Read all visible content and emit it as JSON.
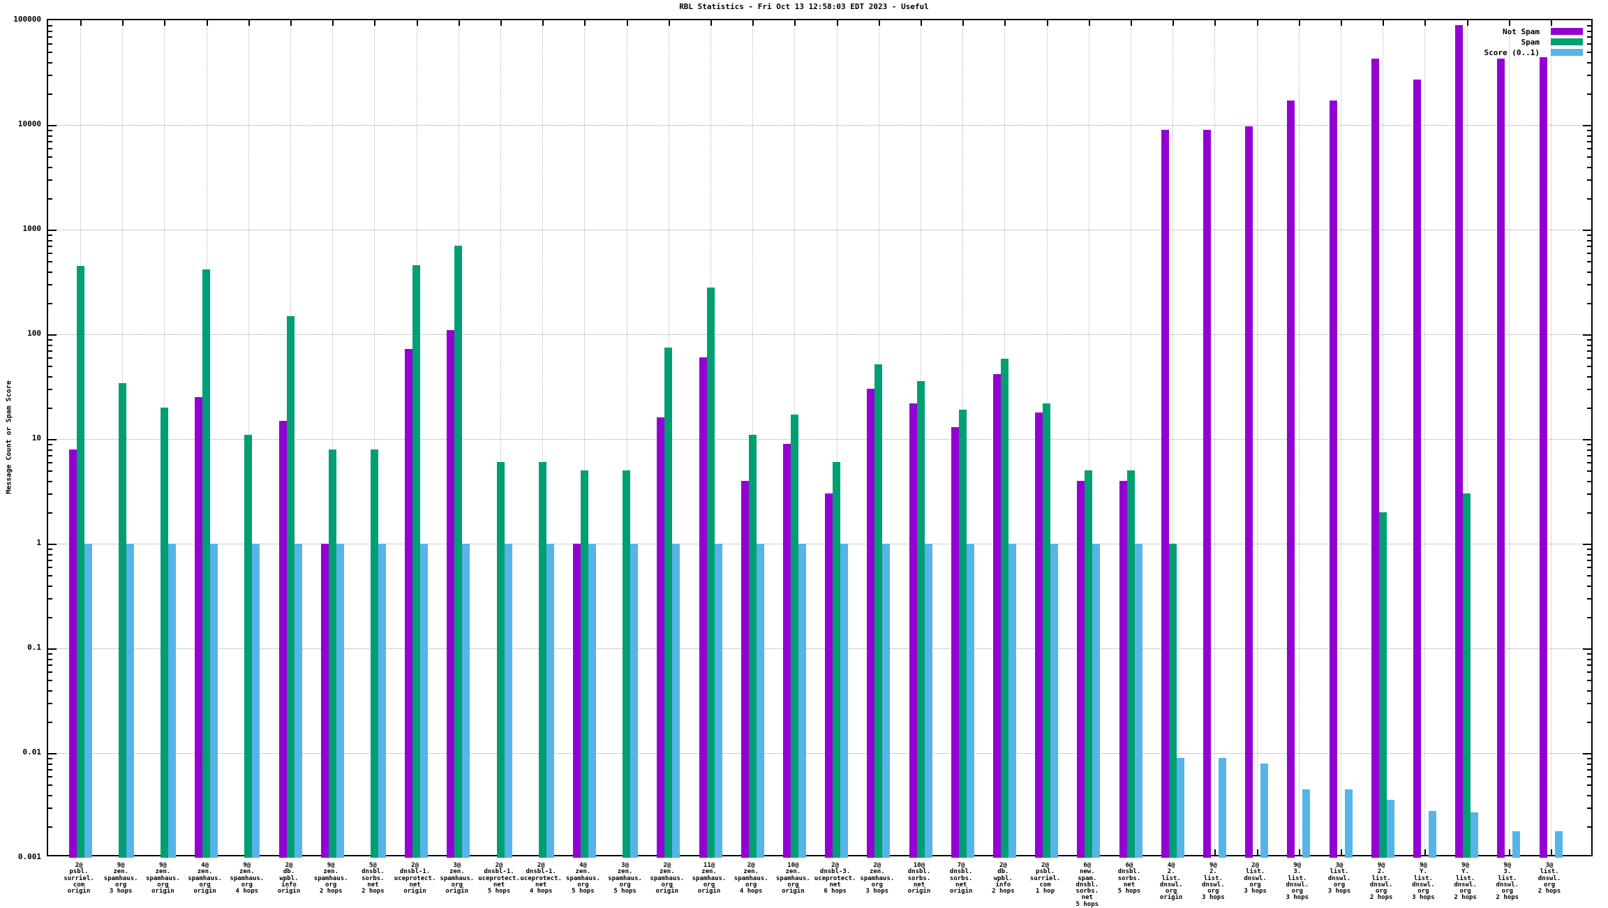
{
  "chart_data": {
    "type": "bar",
    "title": "RBL Statistics - Fri Oct 13 12:58:03 EDT 2023 - Useful",
    "ylabel": "Message Count or Spam Score",
    "yscale": "log",
    "ylim": [
      0.001,
      100000
    ],
    "ytick_labels": [
      "100000",
      "10000",
      "1000",
      "100",
      "10",
      "1",
      "0.1",
      "0.01",
      "0.001"
    ],
    "grid": true,
    "legend_position": "top-right",
    "legend": [
      {
        "name": "Not Spam",
        "color": "#9400d3"
      },
      {
        "name": "Spam",
        "color": "#009e73"
      },
      {
        "name": "Score (0..1)",
        "color": "#56b4e9"
      }
    ],
    "categories": [
      [
        "2@",
        "psbl.",
        "surriel.",
        "com",
        "origin"
      ],
      [
        "9@",
        "zen.",
        "spamhaus.",
        "org",
        "3 hops"
      ],
      [
        "9@",
        "zen.",
        "spamhaus.",
        "org",
        "origin"
      ],
      [
        "4@",
        "zen.",
        "spamhaus.",
        "org",
        "origin"
      ],
      [
        "9@",
        "zen.",
        "spamhaus.",
        "org",
        "4 hops"
      ],
      [
        "2@",
        "db.",
        "wpbl.",
        "info",
        "origin"
      ],
      [
        "9@",
        "zen.",
        "spamhaus.",
        "org",
        "2 hops"
      ],
      [
        "5@",
        "dnsbl.",
        "sorbs.",
        "net",
        "2 hops"
      ],
      [
        "2@",
        "dnsbl-1.",
        "uceprotect.",
        "net",
        "origin"
      ],
      [
        "3@",
        "zen.",
        "spamhaus.",
        "org",
        "origin"
      ],
      [
        "2@",
        "dnsbl-1.",
        "uceprotect.",
        "net",
        "5 hops"
      ],
      [
        "2@",
        "dnsbl-1.",
        "uceprotect.",
        "net",
        "4 hops"
      ],
      [
        "4@",
        "zen.",
        "spamhaus.",
        "org",
        "5 hops"
      ],
      [
        "3@",
        "zen.",
        "spamhaus.",
        "org",
        "5 hops"
      ],
      [
        "2@",
        "zen.",
        "spamhaus.",
        "org",
        "origin"
      ],
      [
        "11@",
        "zen.",
        "spamhaus.",
        "org",
        "origin"
      ],
      [
        "2@",
        "zen.",
        "spamhaus.",
        "org",
        "4 hops"
      ],
      [
        "10@",
        "zen.",
        "spamhaus.",
        "org",
        "origin"
      ],
      [
        "2@",
        "dnsbl-3.",
        "uceprotect.",
        "net",
        "6 hops"
      ],
      [
        "2@",
        "zen.",
        "spamhaus.",
        "org",
        "3 hops"
      ],
      [
        "10@",
        "dnsbl.",
        "sorbs.",
        "net",
        "origin"
      ],
      [
        "7@",
        "dnsbl.",
        "sorbs.",
        "net",
        "origin"
      ],
      [
        "2@",
        "db.",
        "wpbl.",
        "info",
        "2 hops"
      ],
      [
        "2@",
        "psbl.",
        "surriel.",
        "com",
        "1 hop"
      ],
      [
        "6@",
        "new.",
        "spam.",
        "dnsbl.",
        "sorbs.",
        "net",
        "5 hops"
      ],
      [
        "6@",
        "dnsbl.",
        "sorbs.",
        "net",
        "5 hops"
      ],
      [
        "4@",
        "2.",
        "list.",
        "dnswl.",
        "org",
        "origin"
      ],
      [
        "9@",
        "2.",
        "list.",
        "dnswl.",
        "org",
        "3 hops"
      ],
      [
        "2@",
        "list.",
        "dnswl.",
        "org",
        "3 hops"
      ],
      [
        "9@",
        "3.",
        "list.",
        "dnswl.",
        "org",
        "3 hops"
      ],
      [
        "3@",
        "list.",
        "dnswl.",
        "org",
        "3 hops"
      ],
      [
        "9@",
        "2.",
        "list.",
        "dnswl.",
        "org",
        "2 hops"
      ],
      [
        "9@",
        "Y.",
        "list.",
        "dnswl.",
        "org",
        "3 hops"
      ],
      [
        "9@",
        "Y.",
        "list.",
        "dnswl.",
        "org",
        "2 hops"
      ],
      [
        "9@",
        "3.",
        "list.",
        "dnswl.",
        "org",
        "2 hops"
      ],
      [
        "3@",
        "list.",
        "dnswl.",
        "org",
        "2 hops"
      ]
    ],
    "series": [
      {
        "name": "Not Spam",
        "color": "#9400d3",
        "values": [
          8,
          0,
          0,
          25,
          0,
          15,
          1,
          0,
          72,
          110,
          0,
          0,
          1,
          0,
          16,
          60,
          4,
          9,
          3,
          30,
          22,
          13,
          42,
          18,
          4,
          4,
          9000,
          9000,
          9700,
          17000,
          17000,
          43000,
          27000,
          90000,
          43000,
          44000
        ]
      },
      {
        "name": "Spam",
        "color": "#009e73",
        "values": [
          450,
          34,
          20,
          420,
          11,
          150,
          8,
          8,
          460,
          700,
          6,
          6,
          5,
          5,
          75,
          280,
          11,
          17,
          6,
          52,
          36,
          19,
          58,
          22,
          5,
          5,
          1,
          0,
          0,
          0,
          0,
          2,
          0,
          3,
          0,
          0
        ]
      },
      {
        "name": "Score (0..1)",
        "color": "#56b4e9",
        "values": [
          1,
          1,
          1,
          1,
          1,
          1,
          1,
          1,
          1,
          1,
          1,
          1,
          1,
          1,
          1,
          1,
          1,
          1,
          1,
          1,
          1,
          1,
          1,
          1,
          1,
          1,
          0.009,
          0.009,
          0.008,
          0.0045,
          0.0045,
          0.0036,
          0.0028,
          0.0027,
          0.0018,
          0.0018
        ]
      }
    ]
  }
}
